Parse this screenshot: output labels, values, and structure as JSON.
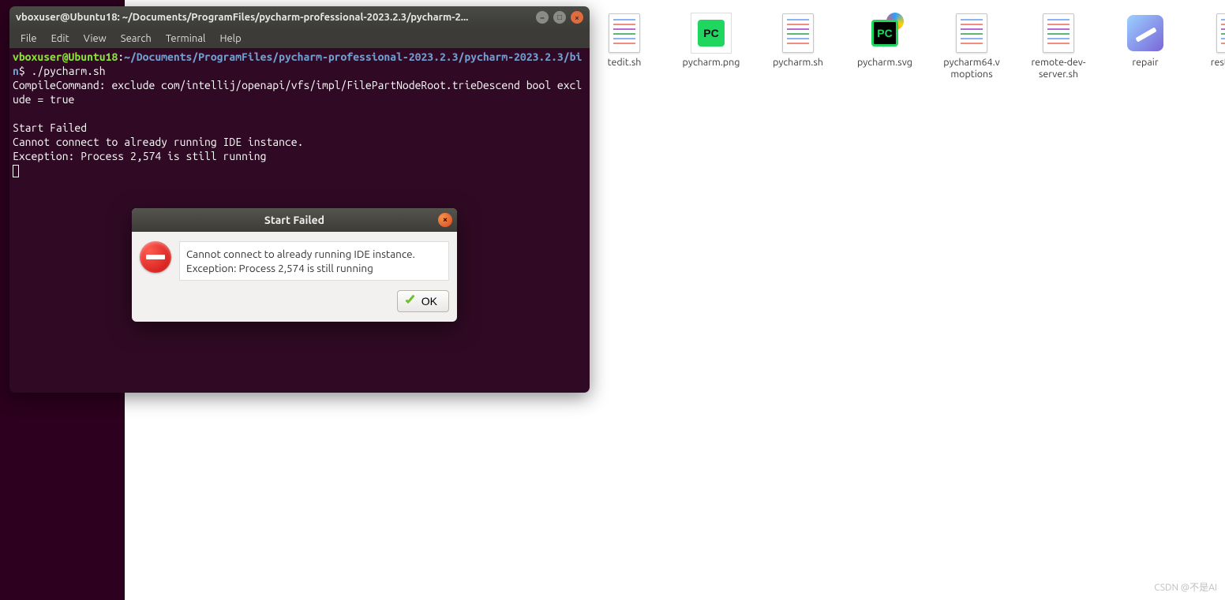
{
  "terminal": {
    "title": "vboxuser@Ubuntu18: ~/Documents/ProgramFiles/pycharm-professional-2023.2.3/pycharm-2...",
    "menus": [
      "File",
      "Edit",
      "View",
      "Search",
      "Terminal",
      "Help"
    ],
    "prompt_user": "vboxuser@Ubuntu18",
    "prompt_sep": ":",
    "prompt_path": "~/Documents/ProgramFiles/pycharm-professional-2023.2.3/pycharm-2023.2.3/bin",
    "prompt_dollar": "$",
    "command": " ./pycharm.sh",
    "output_lines": [
      "CompileCommand: exclude com/intellij/openapi/vfs/impl/FilePartNodeRoot.trieDescend bool exclude = true",
      "",
      "Start Failed",
      "Cannot connect to already running IDE instance.",
      "Exception: Process 2,574 is still running"
    ]
  },
  "dialog": {
    "title": "Start Failed",
    "line1": "Cannot connect to already running IDE instance.",
    "line2": "Exception: Process 2,574 is still running",
    "ok_label": "OK"
  },
  "desktop": {
    "icons": [
      {
        "label": "tedit.sh",
        "type": "doc"
      },
      {
        "label": "pycharm.png",
        "type": "pcpng"
      },
      {
        "label": "pycharm.sh",
        "type": "doc"
      },
      {
        "label": "pycharm.svg",
        "type": "pcsvg"
      },
      {
        "label": "pycharm64.vmoptions",
        "type": "doc"
      },
      {
        "label": "remote-dev-server.sh",
        "type": "doc"
      },
      {
        "label": "repair",
        "type": "repair"
      },
      {
        "label": "restart.py",
        "type": "doc"
      }
    ]
  },
  "watermark": "CSDN @不是AI"
}
